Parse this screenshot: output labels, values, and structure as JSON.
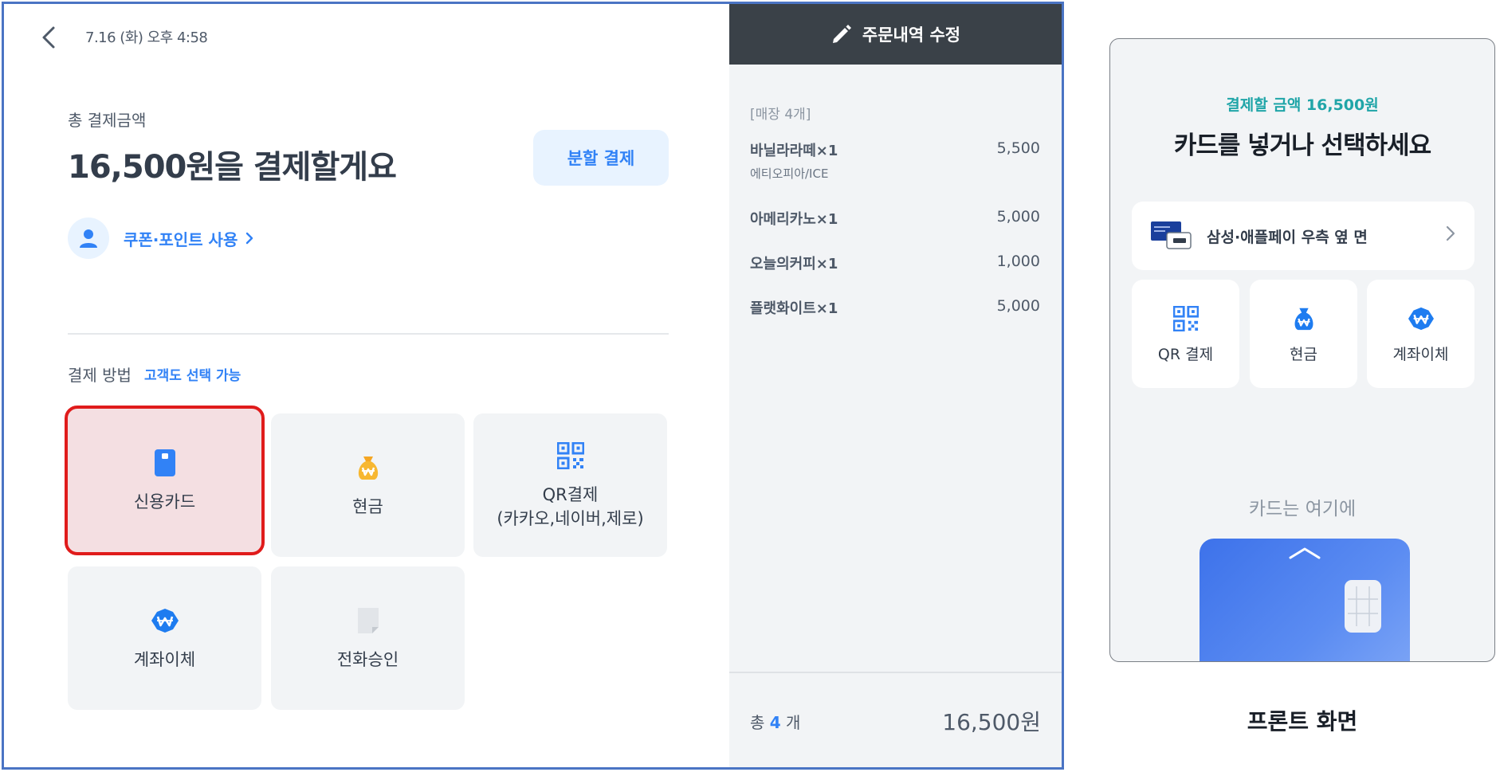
{
  "pos": {
    "datetime": "7.16 (화) 오후 4:58",
    "total_label": "총 결제금액",
    "total_title": "16,500원을 결제할게요",
    "split_button": "분할 결제",
    "coupon_link": "쿠폰·포인트 사용",
    "method_label": "결제 방법",
    "method_sub": "고객도 선택 가능",
    "methods": [
      {
        "label": "신용카드",
        "icon": "credit-card-icon",
        "selected": true
      },
      {
        "label": "현금",
        "icon": "money-bag-icon",
        "selected": false
      },
      {
        "label": "QR결제\n(카카오,네이버,제로)",
        "icon": "qr-code-icon",
        "selected": false
      },
      {
        "label": "계좌이체",
        "icon": "won-transfer-icon",
        "selected": false
      },
      {
        "label": "전화승인",
        "icon": "document-icon",
        "selected": false
      }
    ],
    "colors": {
      "accent": "#3182f6",
      "selected_outline": "#e01b1b",
      "header_bg": "#3a4148"
    }
  },
  "order": {
    "header": "주문내역 수정",
    "store_label": "[매장 4개]",
    "items": [
      {
        "name": "바닐라라떼×1",
        "price": "5,500",
        "option": "에티오피아/ICE"
      },
      {
        "name": "아메리카노×1",
        "price": "5,000",
        "option": ""
      },
      {
        "name": "오늘의커피×1",
        "price": "1,000",
        "option": ""
      },
      {
        "name": "플랫화이트×1",
        "price": "5,000",
        "option": ""
      }
    ],
    "total_prefix": "총",
    "total_count": "4",
    "total_suffix": "개",
    "total_amount": "16,500원"
  },
  "front": {
    "subtitle": "결제할 금액 16,500원",
    "title": "카드를 넣거나 선택하세요",
    "pay_row": "삼성·애플페이 우측 옆 면",
    "tiles": [
      {
        "label": "QR 결제",
        "icon": "qr-code-icon"
      },
      {
        "label": "현금",
        "icon": "money-bag-icon"
      },
      {
        "label": "계좌이체",
        "icon": "won-transfer-icon"
      }
    ],
    "card_hint": "카드는 여기에",
    "caption": "프론트 화면"
  }
}
